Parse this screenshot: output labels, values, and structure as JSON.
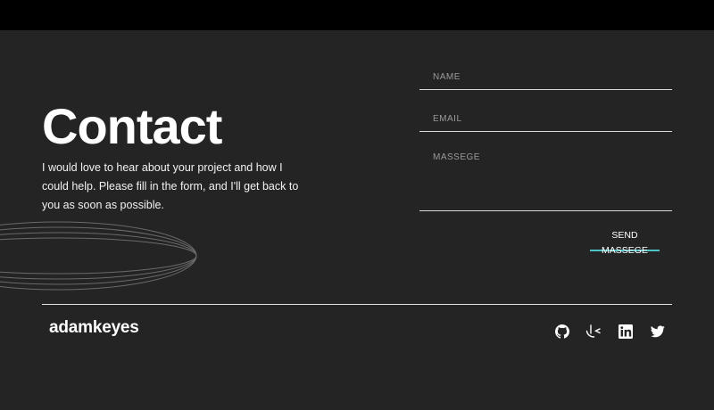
{
  "contact": {
    "title": "Contact",
    "intro": "I would love to hear about your project and how I could help. Please fill in the form, and I'll get back to you as soon as possible."
  },
  "form": {
    "name_label": "NAME",
    "email_label": "EMAIL",
    "message_label": "MASSEGE",
    "send_label": "SEND MASSEGE"
  },
  "footer": {
    "logo": "adamkeyes",
    "social": [
      {
        "icon": "github-icon"
      },
      {
        "icon": "frontend-mentor-icon"
      },
      {
        "icon": "linkedin-icon"
      },
      {
        "icon": "twitter-icon"
      }
    ]
  },
  "colors": {
    "background": "#242424",
    "accent": "#4fc3c7",
    "text": "#ffffff"
  }
}
